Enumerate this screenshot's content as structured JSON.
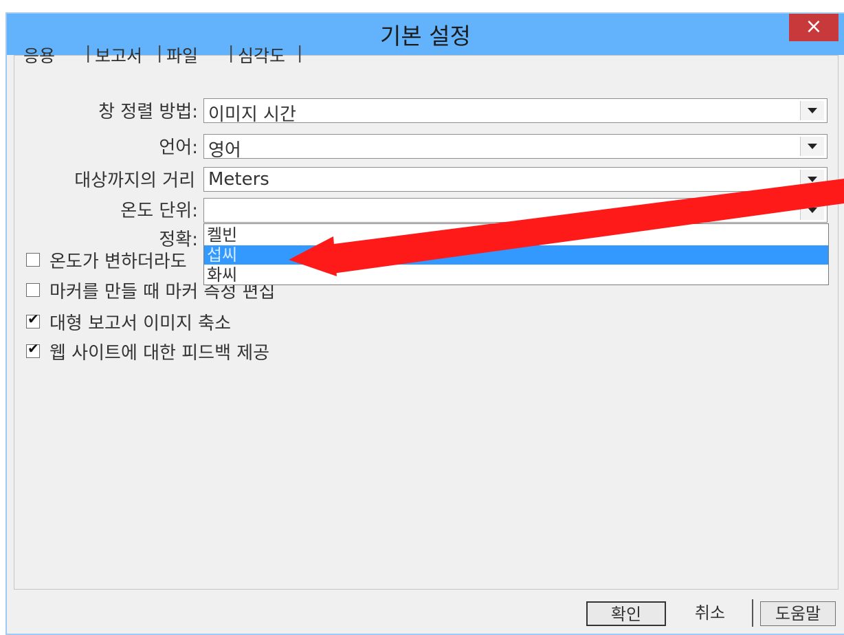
{
  "window": {
    "title": "기본 설정",
    "close_glyph": "×"
  },
  "tabs": [
    {
      "label": "응용"
    },
    {
      "label": "보고서"
    },
    {
      "label": "파일"
    },
    {
      "label": "심각도"
    }
  ],
  "tab_separator": "|",
  "fields": {
    "window_sort": {
      "label": "창 정렬 방법:",
      "value": "이미지 시간"
    },
    "language": {
      "label": "언어:",
      "value": "영어"
    },
    "distance": {
      "label": "대상까지의 거리",
      "value": "Meters"
    },
    "temp_unit": {
      "label": "온도 단위:",
      "value": ""
    },
    "accuracy": {
      "label": "정확:"
    }
  },
  "temp_unit_options": [
    "켈빈",
    "섭씨",
    "화씨"
  ],
  "temp_unit_selected_index": 1,
  "checkboxes": [
    {
      "label": "온도가 변하더라도",
      "checked": false
    },
    {
      "label": "마커를 만들 때 마커 측정 편집",
      "checked": false
    },
    {
      "label": "대형 보고서 이미지 축소",
      "checked": true
    },
    {
      "label": "웹 사이트에 대한 피드백 제공",
      "checked": true
    }
  ],
  "check_glyph": "✔",
  "buttons": {
    "ok": "확인",
    "cancel": "취소",
    "help": "도움말"
  },
  "colors": {
    "titlebar": "#62b3fb",
    "close": "#c8393b",
    "selection": "#3399ff",
    "annotation_arrow": "#ff1a1a"
  }
}
